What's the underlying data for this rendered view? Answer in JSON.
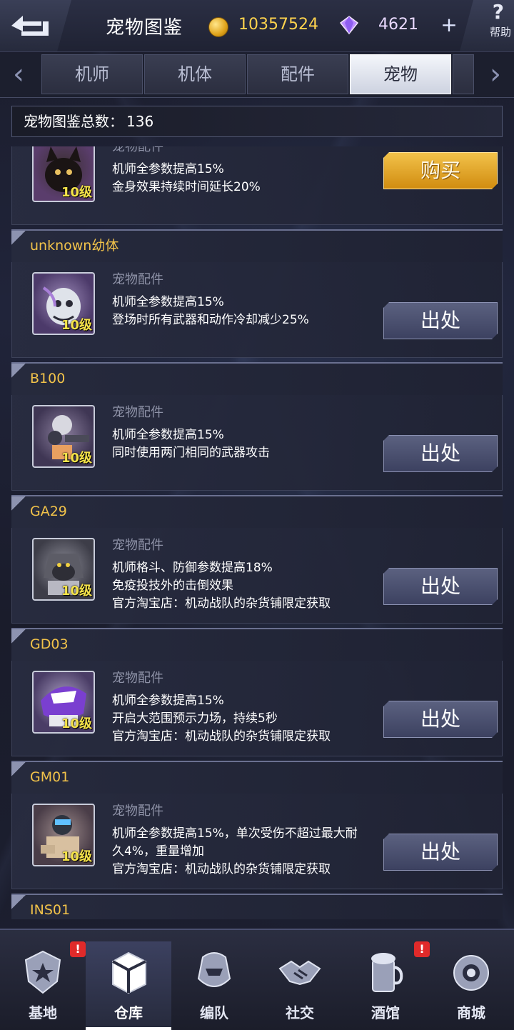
{
  "header": {
    "title": "宠物图鉴",
    "coins": "10357524",
    "gems": "4621",
    "plus": "+",
    "help_q": "?",
    "help_label": "帮助"
  },
  "tabs": [
    {
      "label": "机师"
    },
    {
      "label": "机体"
    },
    {
      "label": "配件"
    },
    {
      "label": "宠物"
    }
  ],
  "total": {
    "label": "宠物图鉴总数：",
    "count": "136"
  },
  "cards": [
    {
      "name": "",
      "type": "宠物配件",
      "level": "10级",
      "lines": [
        "机师全参数提高15%",
        "金身效果持续时间延长20%"
      ],
      "button": "购买"
    },
    {
      "name": "unknown幼体",
      "type": "宠物配件",
      "level": "10级",
      "lines": [
        "机师全参数提高15%",
        "登场时所有武器和动作冷却减少25%"
      ],
      "button": "出处"
    },
    {
      "name": "B100",
      "type": "宠物配件",
      "level": "10级",
      "lines": [
        "机师全参数提高15%",
        "同时使用两门相同的武器攻击"
      ],
      "button": "出处"
    },
    {
      "name": "GA29",
      "type": "宠物配件",
      "level": "10级",
      "lines": [
        "机师格斗、防御参数提高18%",
        "免疫投技外的击倒效果",
        "官方淘宝店：机动战队的杂货铺限定获取"
      ],
      "button": "出处"
    },
    {
      "name": "GD03",
      "type": "宠物配件",
      "level": "10级",
      "lines": [
        "机师全参数提高15%",
        "开启大范围预示力场，持续5秒",
        "官方淘宝店：机动战队的杂货铺限定获取"
      ],
      "button": "出处"
    },
    {
      "name": "GM01",
      "type": "宠物配件",
      "level": "10级",
      "lines": [
        "机师全参数提高15%，单次受伤不超过最大耐",
        "久4%，重量增加",
        "官方淘宝店：机动战队的杂货铺限定获取"
      ],
      "button": "出处"
    },
    {
      "name": "INS01"
    }
  ],
  "nav": [
    {
      "label": "基地",
      "icon": "base-icon",
      "badge": "!"
    },
    {
      "label": "仓库",
      "icon": "warehouse-icon"
    },
    {
      "label": "编队",
      "icon": "squad-icon"
    },
    {
      "label": "社交",
      "icon": "handshake-icon"
    },
    {
      "label": "酒馆",
      "icon": "tavern-icon",
      "badge": "!"
    },
    {
      "label": "商城",
      "icon": "shop-icon"
    }
  ],
  "colors": {
    "accent": "#f2c34a",
    "active_tab": "#f4f6fb",
    "buy": "#f2c24a",
    "badge": "#e02a2a"
  }
}
